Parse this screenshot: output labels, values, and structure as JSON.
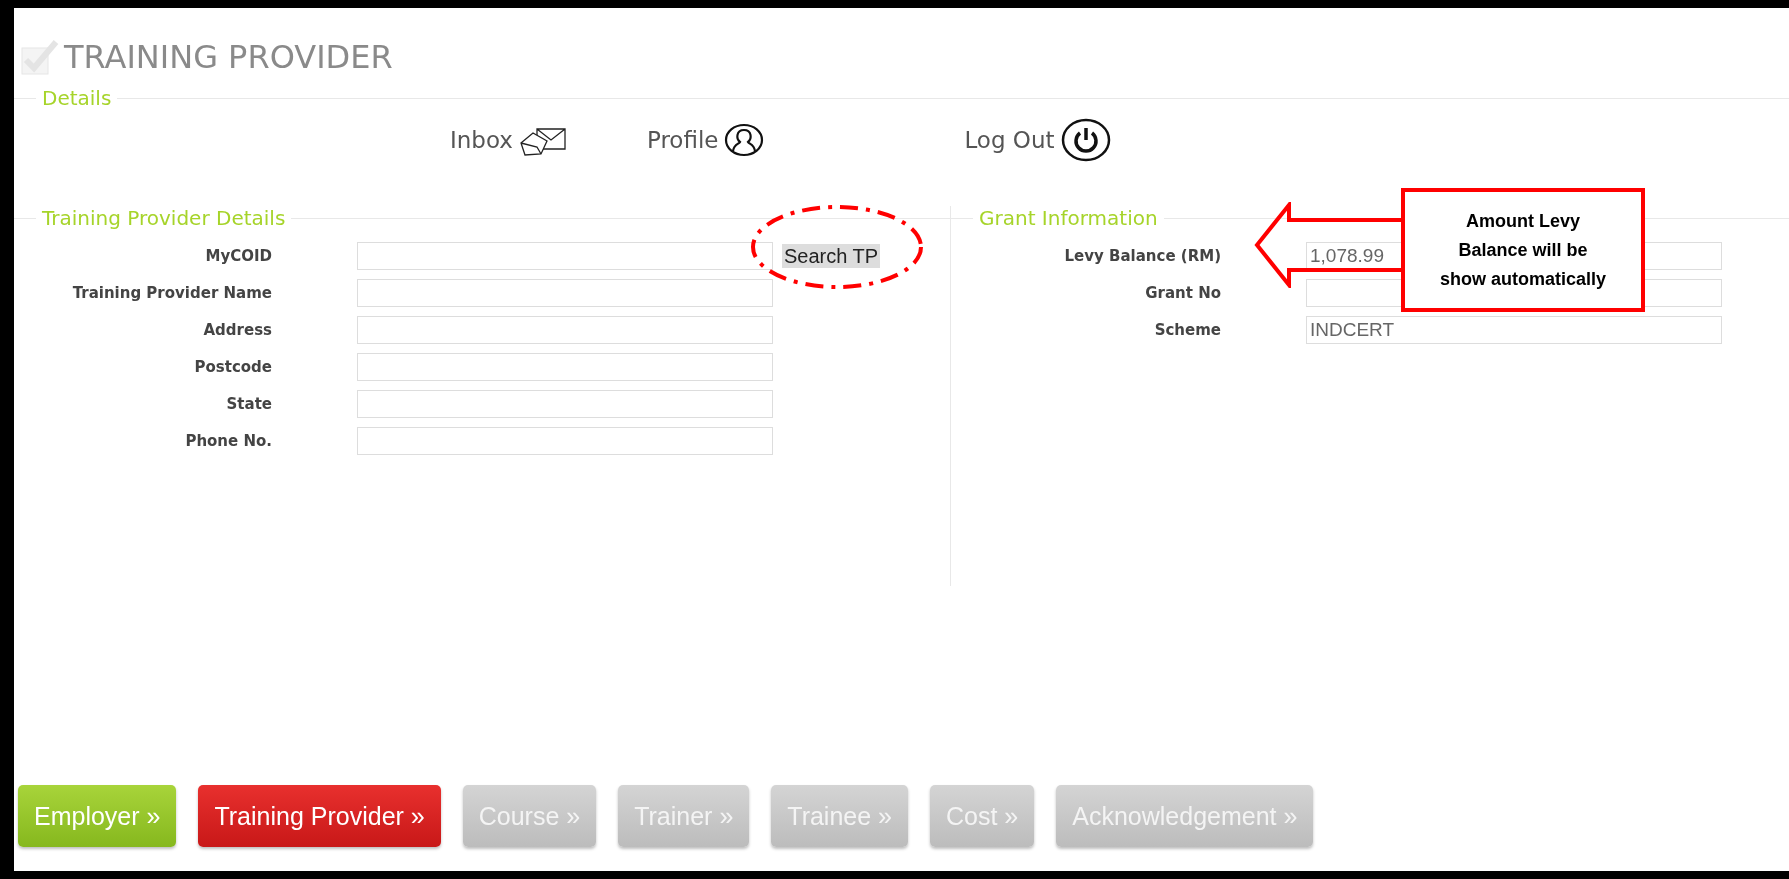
{
  "page_title": "TRAINING PROVIDER",
  "details": {
    "legend": "Details",
    "links": [
      {
        "kind": "inbox",
        "label": "Inbox"
      },
      {
        "kind": "profile",
        "label": "Profile"
      },
      {
        "kind": "logout",
        "label": "Log Out"
      }
    ]
  },
  "provider_details": {
    "legend": "Training Provider Details",
    "search_button": "Search TP",
    "fields": [
      {
        "label": "MyCOID"
      },
      {
        "label": "Training Provider Name"
      },
      {
        "label": "Address"
      },
      {
        "label": "Postcode"
      },
      {
        "label": "State"
      },
      {
        "label": "Phone No."
      }
    ]
  },
  "grant_information": {
    "legend": "Grant Information",
    "fields": [
      {
        "label": "Levy Balance (RM)",
        "value": "1,078.99"
      },
      {
        "label": "Grant No"
      },
      {
        "label": "Scheme",
        "value": "INDCERT"
      }
    ]
  },
  "annotation": {
    "text": "Amount Levy Balance will be show automatically"
  },
  "steps": [
    {
      "label": "Employer »",
      "selected": false,
      "completed": true
    },
    {
      "label": "Training Provider »",
      "selected": true,
      "completed": false
    },
    {
      "label": "Course »",
      "selected": false,
      "completed": false
    },
    {
      "label": "Trainer »",
      "selected": false,
      "completed": false
    },
    {
      "label": "Trainee »",
      "selected": false,
      "completed": false
    },
    {
      "label": "Cost »",
      "selected": false,
      "completed": false
    },
    {
      "label": "Acknowledgement »",
      "selected": false,
      "completed": false
    }
  ]
}
